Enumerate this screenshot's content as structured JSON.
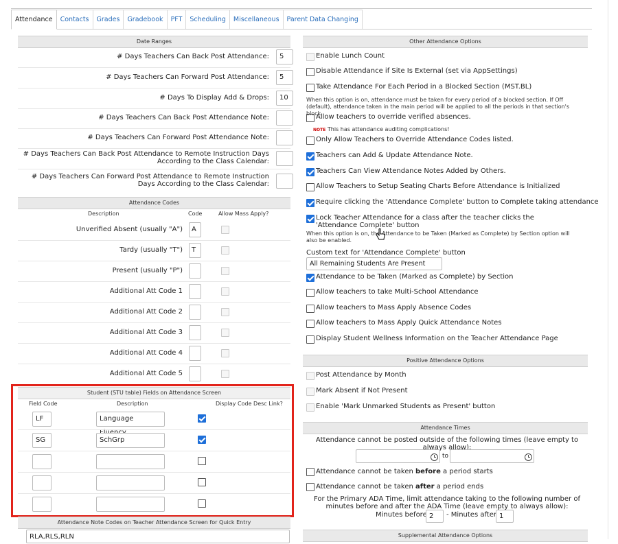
{
  "tabs": [
    "Attendance",
    "Contacts",
    "Grades",
    "Gradebook",
    "PFT",
    "Scheduling",
    "Miscellaneous",
    "Parent Data Changing"
  ],
  "date_ranges": {
    "title": "Date Ranges",
    "rows": [
      {
        "label": "# Days Teachers Can Back Post Attendance:",
        "value": "5"
      },
      {
        "label": "# Days Teachers Can Forward Post Attendance:",
        "value": "5"
      },
      {
        "label": "# Days To Display Add & Drops:",
        "value": "10"
      },
      {
        "label": "# Days Teachers Can Back Post Attendance Note:",
        "value": ""
      },
      {
        "label": "# Days Teachers Can Forward Post Attendance Note:",
        "value": ""
      },
      {
        "label": "# Days Teachers Can Back Post Attendance to Remote Instruction Days According to the Class Calendar:",
        "value": ""
      },
      {
        "label": "# Days Teachers Can Forward Post Attendance to Remote Instruction Days According to the Class Calendar:",
        "value": ""
      }
    ]
  },
  "att_codes": {
    "title": "Attendance Codes",
    "col_desc": "Description",
    "col_code": "Code",
    "col_mass": "Allow Mass Apply?",
    "rows": [
      {
        "desc": "Unverified Absent (usually \"A\")",
        "code": "A"
      },
      {
        "desc": "Tardy (usually \"T\")",
        "code": "T"
      },
      {
        "desc": "Present (usually \"P\")",
        "code": ""
      },
      {
        "desc": "Additional Att Code 1",
        "code": ""
      },
      {
        "desc": "Additional Att Code 2",
        "code": ""
      },
      {
        "desc": "Additional Att Code 3",
        "code": ""
      },
      {
        "desc": "Additional Att Code 4",
        "code": ""
      },
      {
        "desc": "Additional Att Code 5",
        "code": ""
      }
    ]
  },
  "stu_fields": {
    "title": "Student (STU table) Fields on Attendance Screen",
    "col_field": "Field Code",
    "col_desc": "Description",
    "col_link": "Display Code Desc Link?",
    "rows": [
      {
        "code": "LF",
        "desc": "Language Fluency",
        "checked": true
      },
      {
        "code": "SG",
        "desc": "SchGrp",
        "checked": true
      },
      {
        "code": "",
        "desc": "",
        "checked": false
      },
      {
        "code": "",
        "desc": "",
        "checked": false
      },
      {
        "code": "",
        "desc": "",
        "checked": false
      }
    ]
  },
  "note_codes": {
    "title": "Attendance Note Codes on Teacher Attendance Screen for Quick Entry",
    "value": "RLA,RLS,RLN"
  },
  "other_opts": {
    "title": "Other Attendance Options",
    "items": [
      {
        "label": "Enable Lunch Count",
        "checked": false,
        "disabled": true
      },
      {
        "label": "Disable Attendance if Site Is External (set via AppSettings)",
        "checked": false,
        "disabled": false
      },
      {
        "label": "Take Attendance For Each Period in a Blocked Section (MST.BL)",
        "checked": false,
        "disabled": false
      },
      {
        "label": "Allow teachers to override verified absences.",
        "checked": false,
        "disabled": false
      },
      {
        "label": "Only Allow Teachers to Override Attendance Codes listed.",
        "checked": false,
        "disabled": false
      },
      {
        "label": "Teachers can Add & Update Attendance Note.",
        "checked": true,
        "disabled": false
      },
      {
        "label": "Teachers Can View Attendance Notes Added by Others.",
        "checked": true,
        "disabled": false
      },
      {
        "label": "Allow Teachers to Setup Seating Charts Before Attendance is Initialized",
        "checked": false,
        "disabled": false
      },
      {
        "label": "Require clicking the 'Attendance Complete' button to Complete taking attendance",
        "checked": true,
        "disabled": false
      },
      {
        "label": "Lock Teacher Attendance for a class after the teacher clicks the 'Attendance Complete' button",
        "checked": true,
        "disabled": false
      },
      {
        "label": "Attendance to be Taken (Marked as Complete) by Section",
        "checked": true,
        "disabled": false
      },
      {
        "label": "Allow teachers to take Multi-School Attendance",
        "checked": false,
        "disabled": false
      },
      {
        "label": "Allow teachers to Mass Apply Absence Codes",
        "checked": false,
        "disabled": false
      },
      {
        "label": "Allow teachers to Mass Apply Quick Attendance Notes",
        "checked": false,
        "disabled": false
      },
      {
        "label": "Display Student Wellness Information on the Teacher Attendance Page",
        "checked": false,
        "disabled": false
      }
    ],
    "blocked_note": "When this option is on, attendance must be taken for every period of a blocked section. If Off (default), attendance taken in the main period will be applied to all the periods in that section's block.",
    "note_tag": "NOTE",
    "note_text": "This has attendance auditing complications!",
    "lock_note": "When this option is on, the Attendance to be Taken (Marked as Complete) by Section option will also be enabled.",
    "custom_label": "Custom text for 'Attendance Complete' button",
    "custom_value": "All Remaining Students Are Present"
  },
  "positive": {
    "title": "Positive Attendance Options",
    "items": [
      {
        "label": "Post Attendance by Month"
      },
      {
        "label": "Mark Absent if Not Present"
      },
      {
        "label": "Enable 'Mark Unmarked Students as Present' button"
      }
    ]
  },
  "times": {
    "title": "Attendance Times",
    "desc": "Attendance cannot be posted outside of the following times (leave empty to always allow):",
    "to": "to",
    "before_a": "Attendance cannot be taken ",
    "before_b": "before",
    "before_c": " a period starts",
    "after_a": "Attendance cannot be taken ",
    "after_b": "after",
    "after_c": " a period ends",
    "ada": "For the Primary ADA Time, limit attendance taking to the following number of minutes before and after the ADA Time (leave empty to always allow):",
    "min_before": "Minutes before:",
    "min_before_val": "2",
    "min_after": "- Minutes after:",
    "min_after_val": "1"
  },
  "supp": {
    "title": "Supplemental Attendance Options"
  }
}
